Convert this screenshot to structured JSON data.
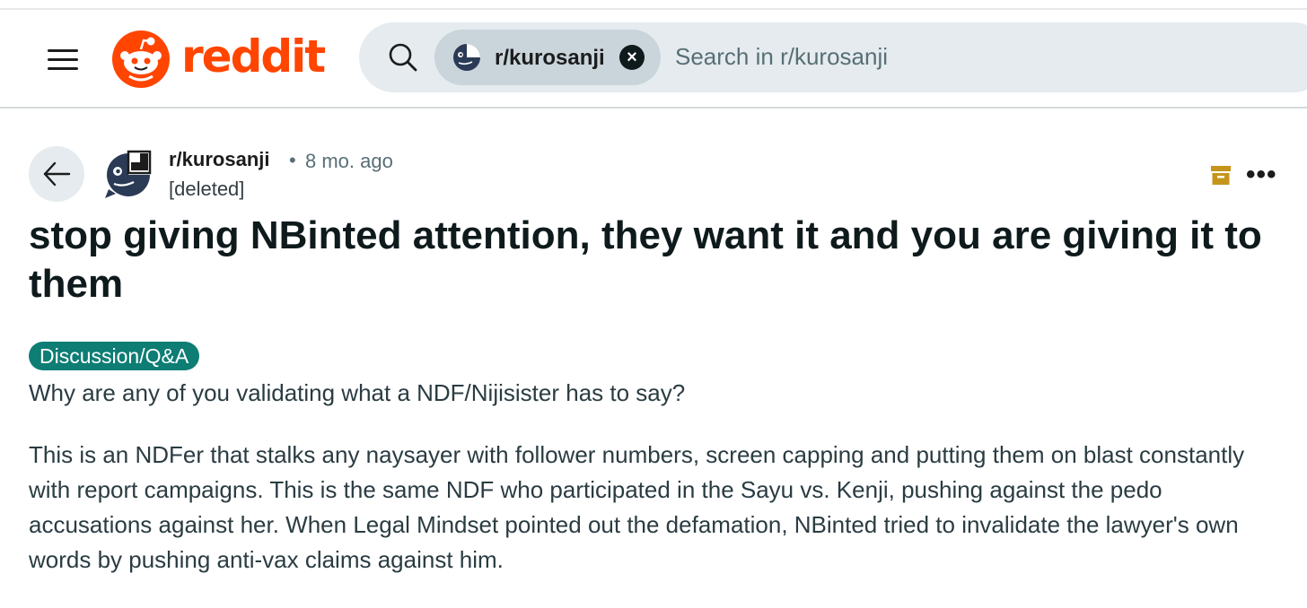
{
  "header": {
    "logo_text": "reddit",
    "search": {
      "chip_label": "r/kurosanji",
      "placeholder": "Search in r/kurosanji"
    }
  },
  "post": {
    "subreddit": "r/kurosanji",
    "separator": "•",
    "time_ago": "8 mo. ago",
    "author": "[deleted]",
    "title": "stop giving NBinted attention, they want it and you are giving it to them",
    "flair": "Discussion/Q&A",
    "body": [
      "Why are any of you validating what a NDF/Nijisister has to say?",
      "This is an NDFer that stalks any naysayer with follower numbers, screen capping and putting them on blast constantly with report campaigns. This is the same NDF who participated in the Sayu vs. Kenji, pushing against the pedo accusations against her. When Legal Mindset pointed out the defamation, NBinted tried to invalidate the lawyer's own words by pushing anti-vax claims against him."
    ]
  },
  "colors": {
    "brand": "#ff4500",
    "flair_bg": "#0e7d74",
    "archive": "#c4951a",
    "search_bg": "#e5ebee",
    "chip_bg": "#c9d4db"
  },
  "icons": [
    "hamburger-menu-icon",
    "reddit-snoo-icon",
    "search-icon",
    "close-icon",
    "back-arrow-icon",
    "archive-icon",
    "more-options-icon"
  ]
}
